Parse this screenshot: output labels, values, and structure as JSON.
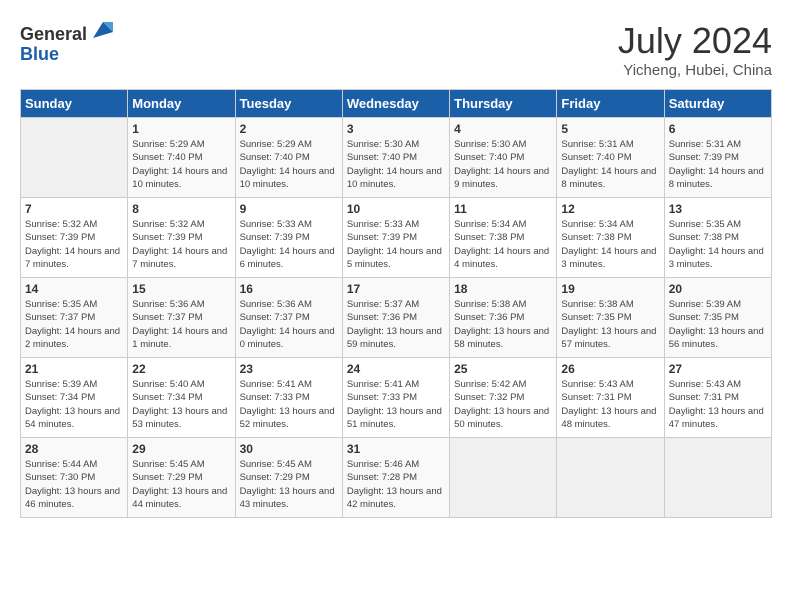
{
  "logo": {
    "text_general": "General",
    "text_blue": "Blue"
  },
  "title": "July 2024",
  "subtitle": "Yicheng, Hubei, China",
  "headers": [
    "Sunday",
    "Monday",
    "Tuesday",
    "Wednesday",
    "Thursday",
    "Friday",
    "Saturday"
  ],
  "weeks": [
    [
      {
        "day": "",
        "sunrise": "",
        "sunset": "",
        "daylight": "",
        "empty": true
      },
      {
        "day": "1",
        "sunrise": "Sunrise: 5:29 AM",
        "sunset": "Sunset: 7:40 PM",
        "daylight": "Daylight: 14 hours and 10 minutes."
      },
      {
        "day": "2",
        "sunrise": "Sunrise: 5:29 AM",
        "sunset": "Sunset: 7:40 PM",
        "daylight": "Daylight: 14 hours and 10 minutes."
      },
      {
        "day": "3",
        "sunrise": "Sunrise: 5:30 AM",
        "sunset": "Sunset: 7:40 PM",
        "daylight": "Daylight: 14 hours and 10 minutes."
      },
      {
        "day": "4",
        "sunrise": "Sunrise: 5:30 AM",
        "sunset": "Sunset: 7:40 PM",
        "daylight": "Daylight: 14 hours and 9 minutes."
      },
      {
        "day": "5",
        "sunrise": "Sunrise: 5:31 AM",
        "sunset": "Sunset: 7:40 PM",
        "daylight": "Daylight: 14 hours and 8 minutes."
      },
      {
        "day": "6",
        "sunrise": "Sunrise: 5:31 AM",
        "sunset": "Sunset: 7:39 PM",
        "daylight": "Daylight: 14 hours and 8 minutes."
      }
    ],
    [
      {
        "day": "7",
        "sunrise": "Sunrise: 5:32 AM",
        "sunset": "Sunset: 7:39 PM",
        "daylight": "Daylight: 14 hours and 7 minutes."
      },
      {
        "day": "8",
        "sunrise": "Sunrise: 5:32 AM",
        "sunset": "Sunset: 7:39 PM",
        "daylight": "Daylight: 14 hours and 7 minutes."
      },
      {
        "day": "9",
        "sunrise": "Sunrise: 5:33 AM",
        "sunset": "Sunset: 7:39 PM",
        "daylight": "Daylight: 14 hours and 6 minutes."
      },
      {
        "day": "10",
        "sunrise": "Sunrise: 5:33 AM",
        "sunset": "Sunset: 7:39 PM",
        "daylight": "Daylight: 14 hours and 5 minutes."
      },
      {
        "day": "11",
        "sunrise": "Sunrise: 5:34 AM",
        "sunset": "Sunset: 7:38 PM",
        "daylight": "Daylight: 14 hours and 4 minutes."
      },
      {
        "day": "12",
        "sunrise": "Sunrise: 5:34 AM",
        "sunset": "Sunset: 7:38 PM",
        "daylight": "Daylight: 14 hours and 3 minutes."
      },
      {
        "day": "13",
        "sunrise": "Sunrise: 5:35 AM",
        "sunset": "Sunset: 7:38 PM",
        "daylight": "Daylight: 14 hours and 3 minutes."
      }
    ],
    [
      {
        "day": "14",
        "sunrise": "Sunrise: 5:35 AM",
        "sunset": "Sunset: 7:37 PM",
        "daylight": "Daylight: 14 hours and 2 minutes."
      },
      {
        "day": "15",
        "sunrise": "Sunrise: 5:36 AM",
        "sunset": "Sunset: 7:37 PM",
        "daylight": "Daylight: 14 hours and 1 minute."
      },
      {
        "day": "16",
        "sunrise": "Sunrise: 5:36 AM",
        "sunset": "Sunset: 7:37 PM",
        "daylight": "Daylight: 14 hours and 0 minutes."
      },
      {
        "day": "17",
        "sunrise": "Sunrise: 5:37 AM",
        "sunset": "Sunset: 7:36 PM",
        "daylight": "Daylight: 13 hours and 59 minutes."
      },
      {
        "day": "18",
        "sunrise": "Sunrise: 5:38 AM",
        "sunset": "Sunset: 7:36 PM",
        "daylight": "Daylight: 13 hours and 58 minutes."
      },
      {
        "day": "19",
        "sunrise": "Sunrise: 5:38 AM",
        "sunset": "Sunset: 7:35 PM",
        "daylight": "Daylight: 13 hours and 57 minutes."
      },
      {
        "day": "20",
        "sunrise": "Sunrise: 5:39 AM",
        "sunset": "Sunset: 7:35 PM",
        "daylight": "Daylight: 13 hours and 56 minutes."
      }
    ],
    [
      {
        "day": "21",
        "sunrise": "Sunrise: 5:39 AM",
        "sunset": "Sunset: 7:34 PM",
        "daylight": "Daylight: 13 hours and 54 minutes."
      },
      {
        "day": "22",
        "sunrise": "Sunrise: 5:40 AM",
        "sunset": "Sunset: 7:34 PM",
        "daylight": "Daylight: 13 hours and 53 minutes."
      },
      {
        "day": "23",
        "sunrise": "Sunrise: 5:41 AM",
        "sunset": "Sunset: 7:33 PM",
        "daylight": "Daylight: 13 hours and 52 minutes."
      },
      {
        "day": "24",
        "sunrise": "Sunrise: 5:41 AM",
        "sunset": "Sunset: 7:33 PM",
        "daylight": "Daylight: 13 hours and 51 minutes."
      },
      {
        "day": "25",
        "sunrise": "Sunrise: 5:42 AM",
        "sunset": "Sunset: 7:32 PM",
        "daylight": "Daylight: 13 hours and 50 minutes."
      },
      {
        "day": "26",
        "sunrise": "Sunrise: 5:43 AM",
        "sunset": "Sunset: 7:31 PM",
        "daylight": "Daylight: 13 hours and 48 minutes."
      },
      {
        "day": "27",
        "sunrise": "Sunrise: 5:43 AM",
        "sunset": "Sunset: 7:31 PM",
        "daylight": "Daylight: 13 hours and 47 minutes."
      }
    ],
    [
      {
        "day": "28",
        "sunrise": "Sunrise: 5:44 AM",
        "sunset": "Sunset: 7:30 PM",
        "daylight": "Daylight: 13 hours and 46 minutes."
      },
      {
        "day": "29",
        "sunrise": "Sunrise: 5:45 AM",
        "sunset": "Sunset: 7:29 PM",
        "daylight": "Daylight: 13 hours and 44 minutes."
      },
      {
        "day": "30",
        "sunrise": "Sunrise: 5:45 AM",
        "sunset": "Sunset: 7:29 PM",
        "daylight": "Daylight: 13 hours and 43 minutes."
      },
      {
        "day": "31",
        "sunrise": "Sunrise: 5:46 AM",
        "sunset": "Sunset: 7:28 PM",
        "daylight": "Daylight: 13 hours and 42 minutes."
      },
      {
        "day": "",
        "sunrise": "",
        "sunset": "",
        "daylight": "",
        "empty": true
      },
      {
        "day": "",
        "sunrise": "",
        "sunset": "",
        "daylight": "",
        "empty": true
      },
      {
        "day": "",
        "sunrise": "",
        "sunset": "",
        "daylight": "",
        "empty": true
      }
    ]
  ]
}
